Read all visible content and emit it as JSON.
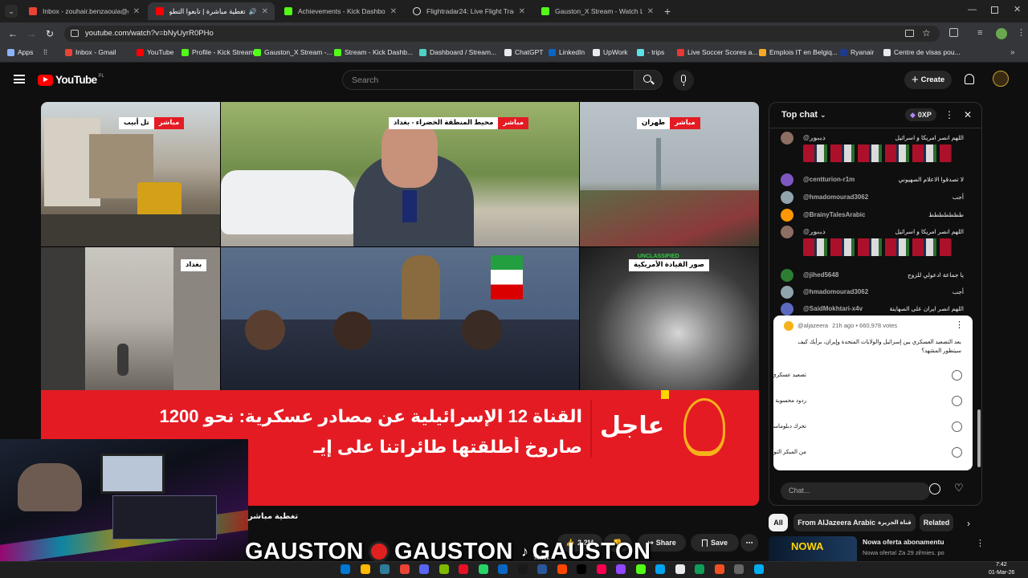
{
  "browser": {
    "tabs": [
      {
        "label": "Inbox - zouhair.benzaouia@gm",
        "color": "#ea4335"
      },
      {
        "label": "تغطية مباشرة | تابعوا التطور",
        "color": "#ff0000"
      },
      {
        "label": "Achievements - Kick Dashboard",
        "color": "#53fc18"
      },
      {
        "label": "Flightradar24: Live Flight Tracke",
        "color": "#e8eaed"
      },
      {
        "label": "Gauston_X Stream - Watch Live",
        "color": "#53fc18"
      }
    ],
    "url": "youtube.com/watch?v=bNyUyrR0PHo",
    "bookmarks": [
      {
        "label": "Apps",
        "color": "#8ab4f8"
      },
      {
        "label": "Inbox - Gmail",
        "color": "#ea4335"
      },
      {
        "label": "YouTube",
        "color": "#ff0000"
      },
      {
        "label": "Profile - Kick Stream...",
        "color": "#53fc18"
      },
      {
        "label": "Gauston_X Stream -...",
        "color": "#53fc18"
      },
      {
        "label": "Stream - Kick Dashb...",
        "color": "#53fc18"
      },
      {
        "label": "Dashboard / Stream...",
        "color": "#4fd1c5"
      },
      {
        "label": "ChatGPT",
        "color": "#e8eaed"
      },
      {
        "label": "LinkedIn",
        "color": "#0a66c2"
      },
      {
        "label": "UpWork",
        "color": "#e8eaed"
      },
      {
        "label": "- trips",
        "color": "#5ce1e6"
      },
      {
        "label": "Live Soccer Scores a...",
        "color": "#e53935"
      },
      {
        "label": "Emplois IT en Belgiq...",
        "color": "#f9a825"
      },
      {
        "label": "Ryanair",
        "color": "#1e3a8a"
      },
      {
        "label": "Centre de visas pou...",
        "color": "#e8eaed"
      }
    ]
  },
  "youtube": {
    "logo_text": "YouTube",
    "country_code": "PL",
    "search_placeholder": "Search",
    "create_label": "Create"
  },
  "video": {
    "tags": {
      "live": "مباشر",
      "telaviv": "تل أبيب",
      "baghdad_green": "محيط المنطقة الخضراء - بغداد",
      "tehran": "طهران",
      "baghdad": "بغداد",
      "us_command": "صور القيادة الأمريكية",
      "unclassified": "UNCLASSIFIED"
    },
    "breaking": "عاجل",
    "ticker_line1": "القناة 12 الإسرائيلية عن مصادر عسكرية: نحو 1200",
    "ticker_line2": "صاروخ أطلقتها طائراتنا على إيـ",
    "title": "تغطية مباشر"
  },
  "actions": {
    "likes": "2.2M",
    "share": "Share",
    "save": "Save"
  },
  "overlay": {
    "word1": "GAUSTON",
    "word2": "GAUSTON",
    "word3": "GAUSTON",
    "tiktok": "TikTok"
  },
  "chat": {
    "title": "Top chat",
    "xp": "0XP",
    "messages": [
      {
        "author": "@ذيبور",
        "text": "اللهم انصر امريكا و اسرائيل",
        "color": "#8d6e63"
      },
      {
        "author": "@centturion-r1m",
        "text": "لا تصدقوا الاعلام الصهيوني",
        "color": "#7e57c2"
      },
      {
        "author": "@hmadomourad3062",
        "text": "أجب",
        "color": "#90a4ae"
      },
      {
        "author": "@BrainyTalesArabic",
        "text": "ططططططط",
        "color": "#ff9800"
      },
      {
        "author": "@ذيبور",
        "text": "اللهم انصر امريكا و اسرائيل",
        "color": "#8d6e63"
      },
      {
        "author": "@jihed5648",
        "text": "يا جماعة ادعولي للزوج",
        "color": "#2e7d32"
      },
      {
        "author": "@hmadomourad3062",
        "text": "أجب",
        "color": "#90a4ae"
      },
      {
        "author": "@SaidMokhtari-x4v",
        "text": "اللهم انصر ايران على الصهاينة",
        "color": "#5c6bc0"
      }
    ],
    "poll": {
      "author": "@aljazeera",
      "meta": "21h ago • 660,978 votes",
      "question": "بعد التصعيد العسكري بين إسرائيل والولايات المتحدة وإيران، برأيك كيف سيتطور المشهد؟",
      "options": [
        "تصعيد عسكري أوسع في المنطقة",
        "ردود محسوبة دون الانزلاق لحرب شاملة",
        "تحرك دبلوماسي عاجل لاحتواء الأزمة",
        "من المبكر التوقع"
      ]
    },
    "input_placeholder": "Chat..."
  },
  "filters": [
    "All",
    "From AlJazeera Arabic",
    "Related"
  ],
  "sidebar_video": {
    "title": "Nowa oferta abonamentu",
    "subtitle": "Nowa oferta! Za 29 zł/mies. po"
  },
  "clock": {
    "time": "7:42",
    "date": "01-Mar-26"
  }
}
